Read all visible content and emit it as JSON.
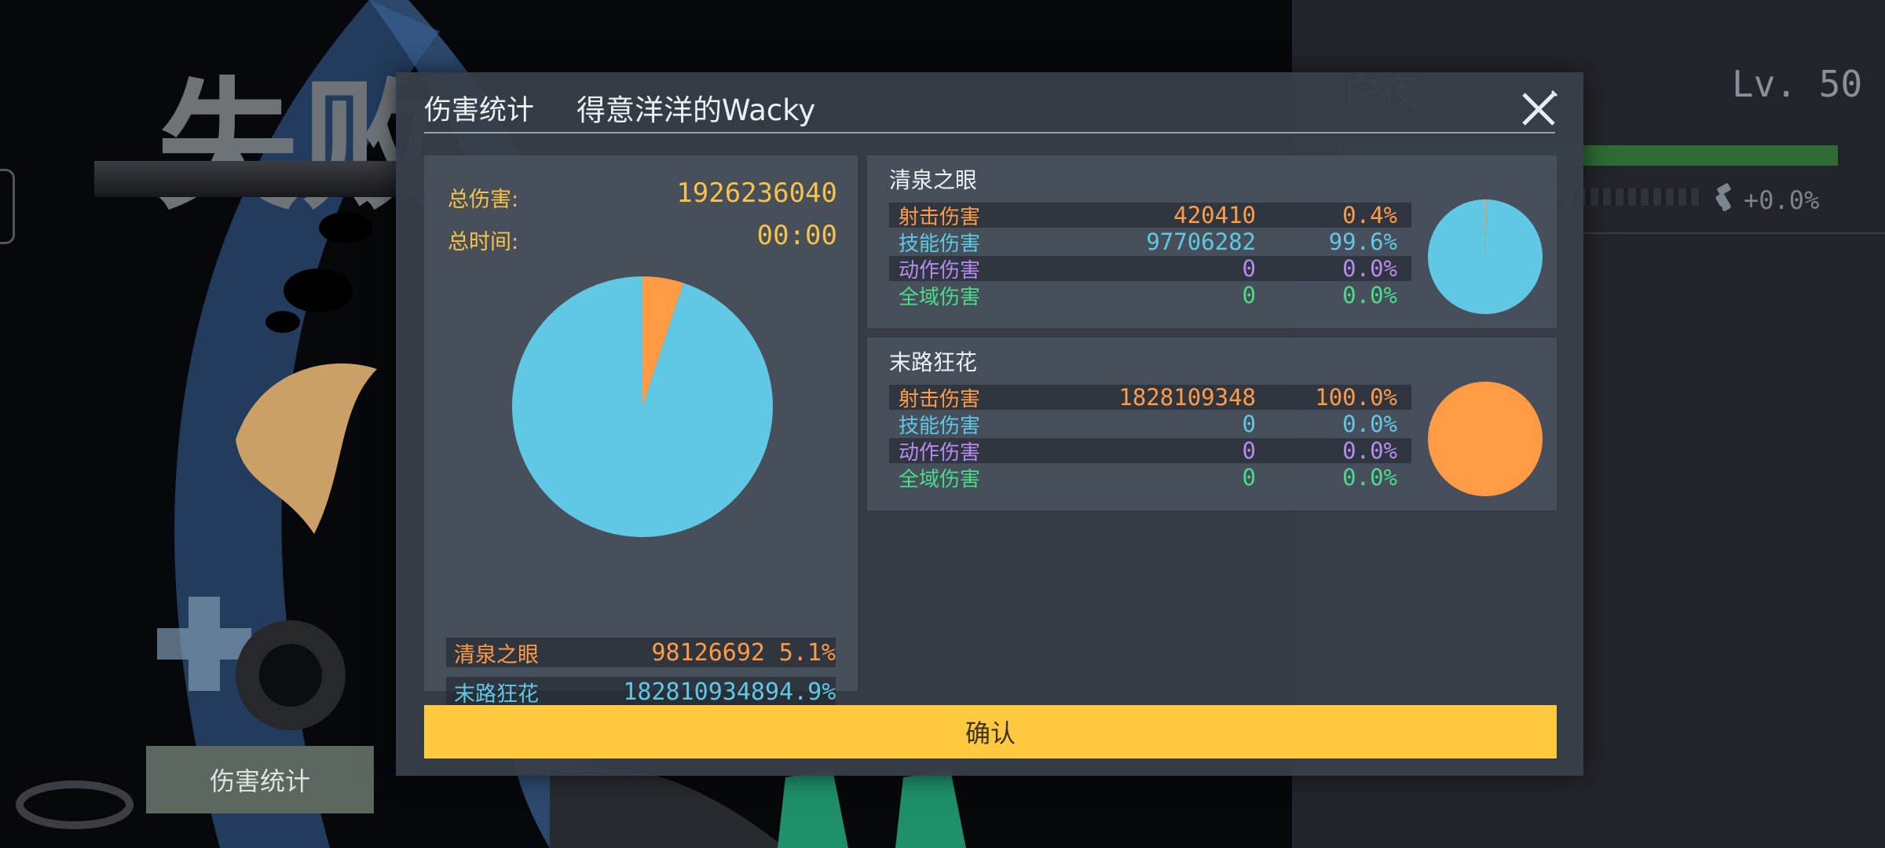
{
  "background": {
    "result_title": "失败",
    "player_name": "白夜",
    "player_level": "Lv. 50",
    "exp_fraction": 1.0,
    "bonus_value": "+0.0%",
    "bonus_icon": "flashlight-icon",
    "stats_tab_label": "伤害统计"
  },
  "modal": {
    "title": "伤害统计",
    "subtitle": "得意洋洋的Wacky",
    "close_icon": "close-icon",
    "total_damage_label": "总伤害:",
    "total_damage_value": "1926236040",
    "total_time_label": "总时间:",
    "total_time_value": "00:00",
    "confirm_label": "确认"
  },
  "colors": {
    "shoot": "#ff9b45",
    "skill": "#60c8e4",
    "action": "#b88af0",
    "global": "#49dd8a",
    "confirm": "#ffc93f"
  },
  "chart_data": {
    "type": "pie",
    "slices": [
      {
        "label": "清泉之眼",
        "value": 98126692,
        "percent": "5.1%",
        "color": "#ff9b45"
      },
      {
        "label": "末路狂花",
        "value": 1828109348,
        "percent": "94.9%",
        "color": "#60c8e4"
      }
    ]
  },
  "characters": [
    {
      "name": "清泉之眼",
      "rows": [
        {
          "label": "射击伤害",
          "value": "420410",
          "percent": "0.4%"
        },
        {
          "label": "技能伤害",
          "value": "97706282",
          "percent": "99.6%"
        },
        {
          "label": "动作伤害",
          "value": "0",
          "percent": "0.0%"
        },
        {
          "label": "全域伤害",
          "value": "0",
          "percent": "0.0%"
        }
      ],
      "pie": [
        0.4,
        99.6,
        0,
        0
      ]
    },
    {
      "name": "末路狂花",
      "rows": [
        {
          "label": "射击伤害",
          "value": "1828109348",
          "percent": "100.0%"
        },
        {
          "label": "技能伤害",
          "value": "0",
          "percent": "0.0%"
        },
        {
          "label": "动作伤害",
          "value": "0",
          "percent": "0.0%"
        },
        {
          "label": "全域伤害",
          "value": "0",
          "percent": "0.0%"
        }
      ],
      "pie": [
        100,
        0,
        0,
        0
      ]
    }
  ]
}
